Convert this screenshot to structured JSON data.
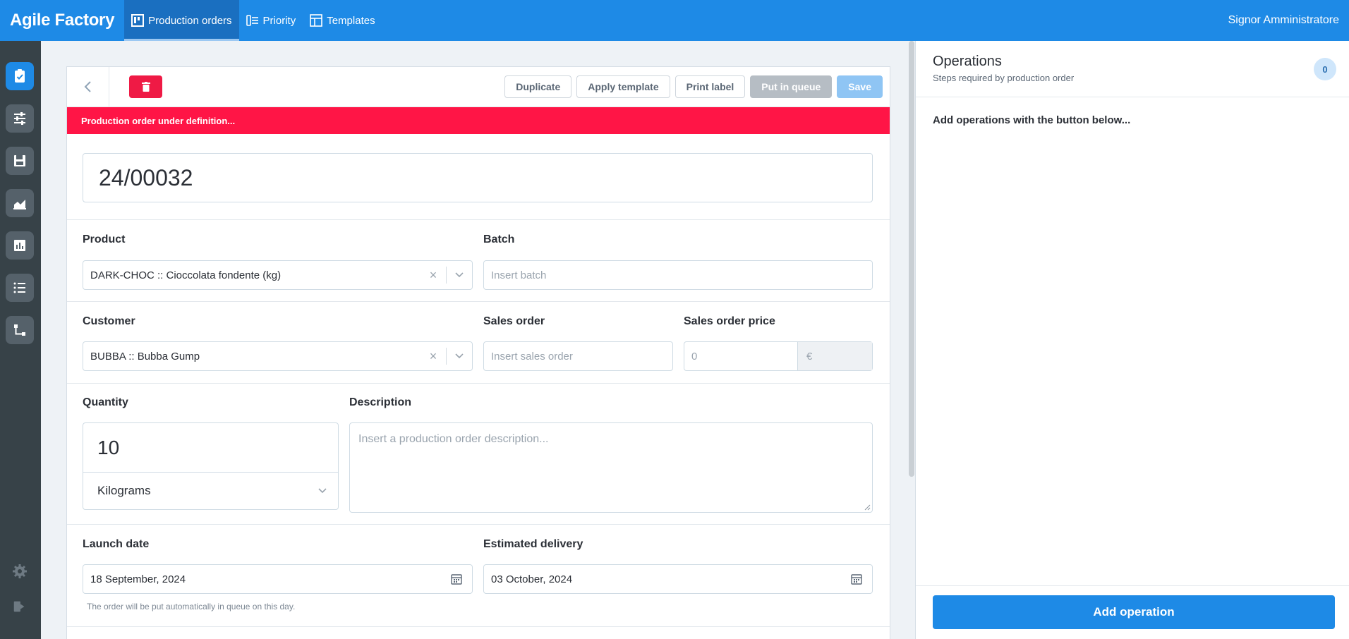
{
  "app": {
    "title": "Agile Factory",
    "user": "Signor Amministratore"
  },
  "nav": {
    "tabs": [
      {
        "label": "Production orders",
        "icon": "kanban-icon"
      },
      {
        "label": "Priority",
        "icon": "priority-list-icon"
      },
      {
        "label": "Templates",
        "icon": "template-icon"
      }
    ]
  },
  "sidebar": {
    "items": [
      "clipboard-check-icon",
      "sliders-icon",
      "save-icon",
      "area-chart-icon",
      "bar-chart-icon",
      "list-icon",
      "flow-icon"
    ],
    "bottom": [
      "settings-icon",
      "logout-icon"
    ]
  },
  "toolbar": {
    "duplicate": "Duplicate",
    "apply_template": "Apply template",
    "print_label": "Print label",
    "put_in_queue": "Put in queue",
    "save": "Save"
  },
  "banner": "Production order under definition...",
  "order": {
    "code": "24/00032",
    "product_label": "Product",
    "product_value": "DARK-CHOC :: Cioccolata fondente (kg)",
    "batch_label": "Batch",
    "batch_placeholder": "Insert batch",
    "customer_label": "Customer",
    "customer_value": "BUBBA :: Bubba Gump",
    "sales_order_label": "Sales order",
    "sales_order_placeholder": "Insert sales order",
    "sales_price_label": "Sales order price",
    "sales_price_placeholder": "0",
    "currency": "€",
    "quantity_label": "Quantity",
    "quantity_value": "10",
    "unit": "Kilograms",
    "description_label": "Description",
    "description_placeholder": "Insert a production order description...",
    "launch_label": "Launch date",
    "launch_value": "18 September, 2024",
    "launch_hint": "The order will be put automatically in queue on this day.",
    "delivery_label": "Estimated delivery",
    "delivery_value": "03 October, 2024"
  },
  "operations": {
    "title": "Operations",
    "subtitle": "Steps required by production order",
    "count": "0",
    "empty": "Add operations with the button below...",
    "add_button": "Add operation"
  },
  "colors": {
    "primary": "#1e8ae6",
    "danger": "#ff1546",
    "sidebar": "#374248"
  }
}
